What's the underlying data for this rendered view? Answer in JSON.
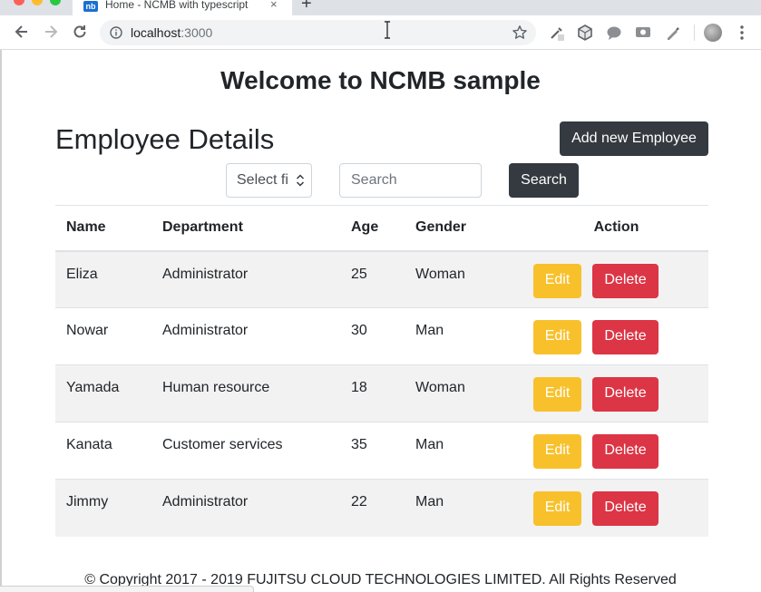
{
  "browser": {
    "tab_title": "Home - NCMB with typescript",
    "tab_favicon_text": "nb",
    "tab_close": "×",
    "new_tab": "+",
    "url_host": "localhost",
    "url_port": ":3000"
  },
  "page": {
    "welcome": "Welcome to NCMB sample",
    "section_title": "Employee Details",
    "add_button": "Add new Employee",
    "filter_select": "Select field",
    "search_placeholder": "Search",
    "search_button": "Search",
    "footer": "© Copyright 2017 - 2019 FUJITSU CLOUD TECHNOLOGIES LIMITED. All Rights Reserved"
  },
  "table": {
    "headers": [
      "Name",
      "Department",
      "Age",
      "Gender",
      "Action"
    ],
    "edit_label": "Edit",
    "delete_label": "Delete",
    "rows": [
      {
        "name": "Eliza",
        "department": "Administrator",
        "age": "25",
        "gender": "Woman"
      },
      {
        "name": "Nowar",
        "department": "Administrator",
        "age": "30",
        "gender": "Man"
      },
      {
        "name": "Yamada",
        "department": "Human resource",
        "age": "18",
        "gender": "Woman"
      },
      {
        "name": "Kanata",
        "department": "Customer services",
        "age": "35",
        "gender": "Man"
      },
      {
        "name": "Jimmy",
        "department": "Administrator",
        "age": "22",
        "gender": "Man"
      }
    ]
  },
  "colors": {
    "dark_button": "#343a40",
    "edit_button": "#f8c12c",
    "delete_button": "#dc3545",
    "striped_row": "#f2f2f2"
  }
}
